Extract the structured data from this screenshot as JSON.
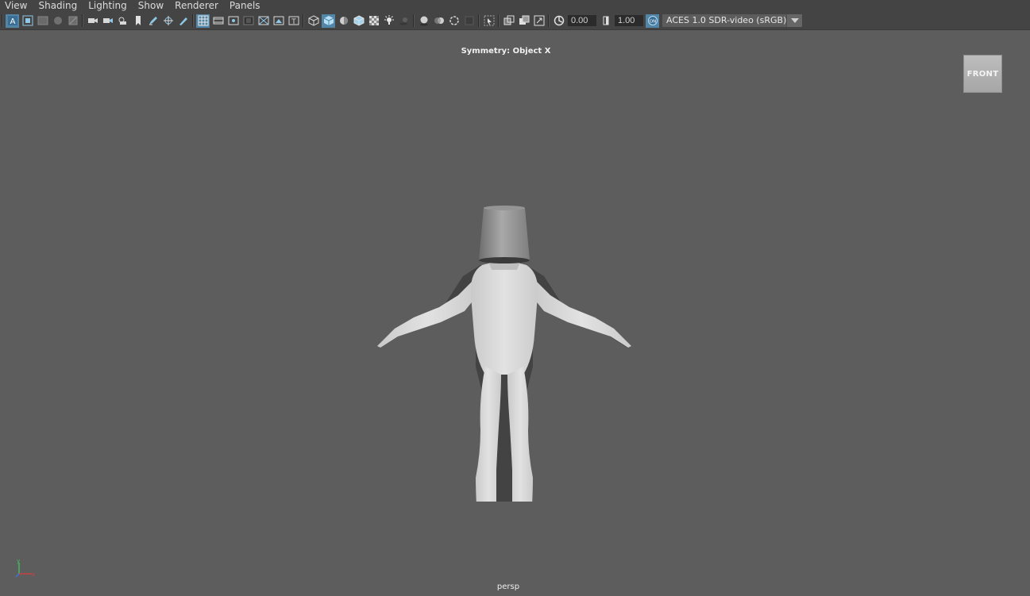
{
  "menu": [
    "View",
    "Shading",
    "Lighting",
    "Show",
    "Renderer",
    "Panels"
  ],
  "toolbar": {
    "exposure_value": "0.00",
    "gamma_value": "1.00",
    "colorspace": "ACES 1.0 SDR-video (sRGB)",
    "icons": [
      "select-camera-icon",
      "camera-attributes-icon",
      "bookmarks-icon",
      "image-plane-icon",
      "2d-pan-zoom-icon",
      "camera-icon",
      "camera-snapshot-icon",
      "camera-sequencer-icon",
      "bookmark-icon",
      "grease-pencil-icon",
      "pencil-icon",
      "grid-icon",
      "film-gate-icon",
      "resolution-gate-icon",
      "gate-mask-icon",
      "field-chart-icon",
      "safe-action-icon",
      "safe-title-icon",
      "wireframe-icon",
      "smooth-shade-icon",
      "default-material-icon",
      "wireframe-on-shaded-icon",
      "textured-icon",
      "use-all-lights-icon",
      "shadows-icon",
      "screen-space-ao-icon",
      "motion-blur-icon",
      "anti-aliasing-icon",
      "depth-of-field-icon",
      "isolate-select-icon",
      "xray-icon",
      "xray-active-components-icon",
      "xray-joints-icon",
      "exposure-icon",
      "gamma-icon",
      "color-management-icon"
    ]
  },
  "viewport": {
    "symmetry_label": "Symmetry: Object X",
    "viewcube_label": "FRONT",
    "camera_name": "persp",
    "axis": {
      "y": "y",
      "x": "x"
    }
  },
  "colors": {
    "viewport_bg": "#5d5d5d",
    "bar_bg": "#444444",
    "active_button": "#5285a6",
    "axis_x": "#d04040",
    "axis_y": "#40c060",
    "axis_z": "#4070e0"
  }
}
